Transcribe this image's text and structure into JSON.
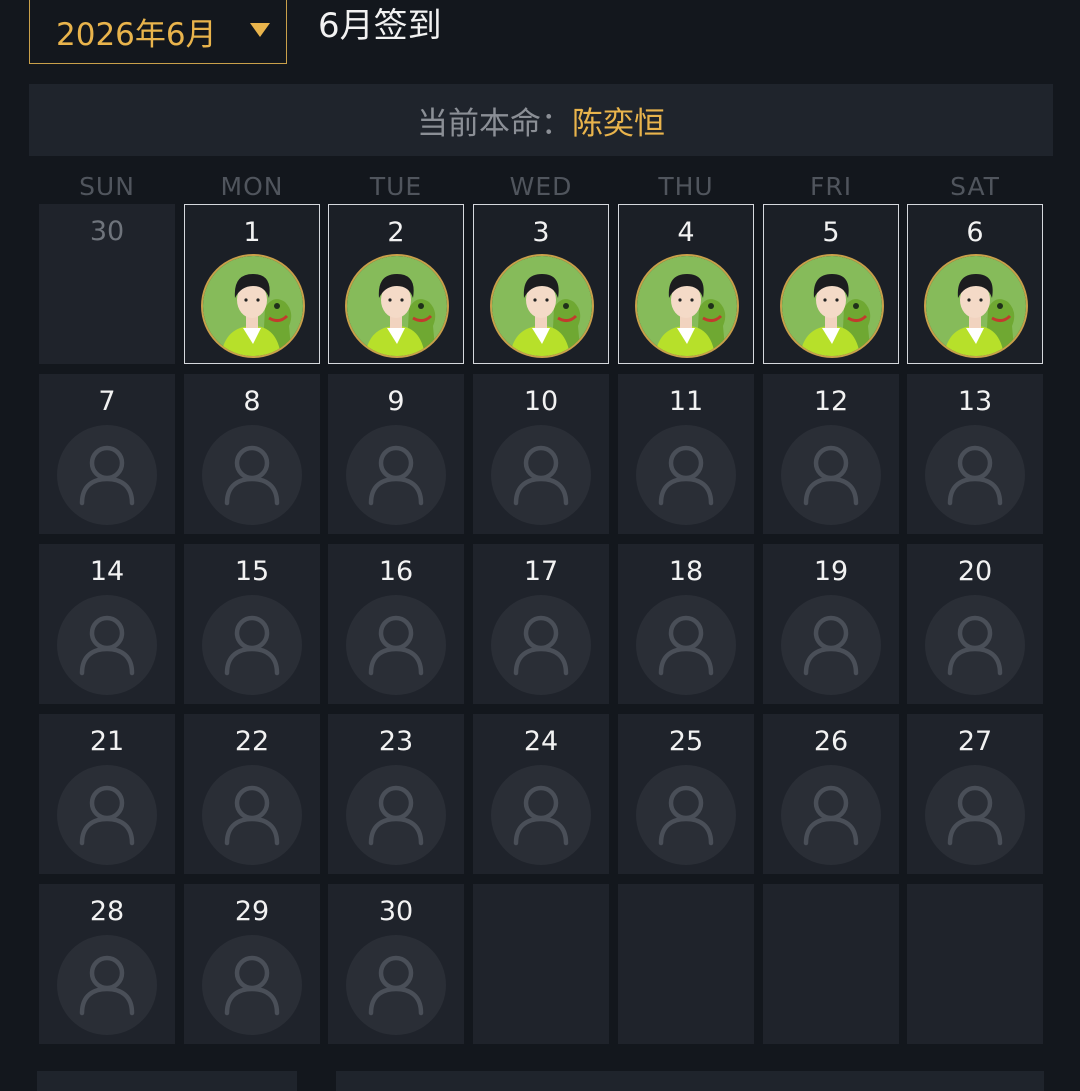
{
  "header": {
    "month_selector": "2026年6月",
    "title": "6月签到"
  },
  "banner": {
    "label": "当前本命：",
    "name": "陈奕恒"
  },
  "weekdays": [
    "SUN",
    "MON",
    "TUE",
    "WED",
    "THU",
    "FRI",
    "SAT"
  ],
  "calendar": {
    "weeks": [
      [
        {
          "day": "30",
          "state": "other"
        },
        {
          "day": "1",
          "state": "checked"
        },
        {
          "day": "2",
          "state": "checked"
        },
        {
          "day": "3",
          "state": "checked"
        },
        {
          "day": "4",
          "state": "checked"
        },
        {
          "day": "5",
          "state": "checked"
        },
        {
          "day": "6",
          "state": "checked"
        }
      ],
      [
        {
          "day": "7",
          "state": "empty"
        },
        {
          "day": "8",
          "state": "empty"
        },
        {
          "day": "9",
          "state": "empty"
        },
        {
          "day": "10",
          "state": "empty"
        },
        {
          "day": "11",
          "state": "empty"
        },
        {
          "day": "12",
          "state": "empty"
        },
        {
          "day": "13",
          "state": "empty"
        }
      ],
      [
        {
          "day": "14",
          "state": "empty"
        },
        {
          "day": "15",
          "state": "empty"
        },
        {
          "day": "16",
          "state": "empty"
        },
        {
          "day": "17",
          "state": "empty"
        },
        {
          "day": "18",
          "state": "empty"
        },
        {
          "day": "19",
          "state": "empty"
        },
        {
          "day": "20",
          "state": "empty"
        }
      ],
      [
        {
          "day": "21",
          "state": "empty"
        },
        {
          "day": "22",
          "state": "empty"
        },
        {
          "day": "23",
          "state": "empty"
        },
        {
          "day": "24",
          "state": "empty"
        },
        {
          "day": "25",
          "state": "empty"
        },
        {
          "day": "26",
          "state": "empty"
        },
        {
          "day": "27",
          "state": "empty"
        }
      ],
      [
        {
          "day": "28",
          "state": "empty"
        },
        {
          "day": "29",
          "state": "empty"
        },
        {
          "day": "30",
          "state": "empty"
        },
        {
          "day": "",
          "state": "blank"
        },
        {
          "day": "",
          "state": "blank"
        },
        {
          "day": "",
          "state": "blank"
        },
        {
          "day": "",
          "state": "blank"
        }
      ]
    ]
  },
  "icons": {
    "placeholder": "user-placeholder-icon",
    "checked": "idol-avatar-photo",
    "caret": "caret-down-icon"
  },
  "colors": {
    "accent": "#e9b44c",
    "background": "#13171d",
    "cell": "#1f232b"
  }
}
